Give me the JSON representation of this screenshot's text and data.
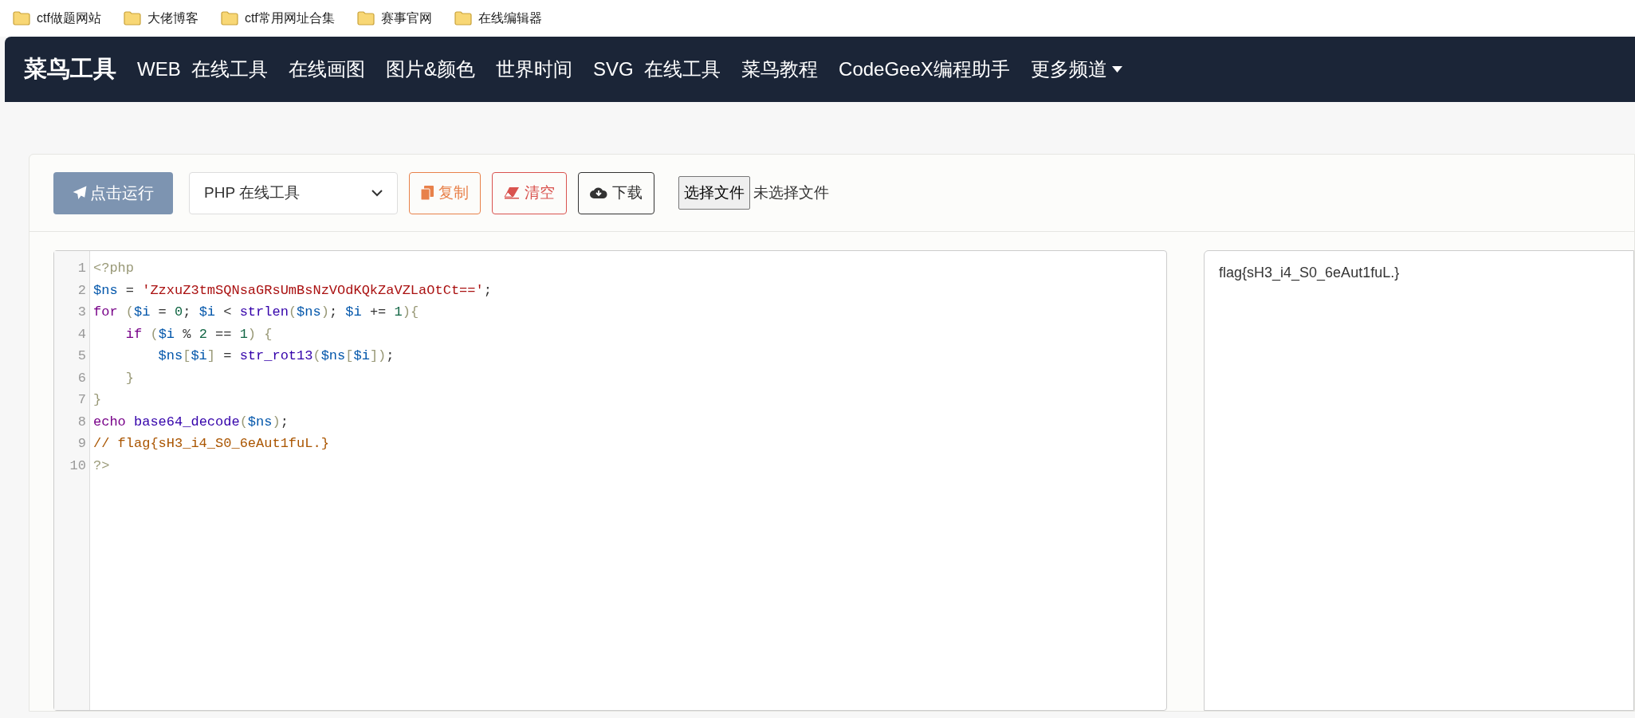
{
  "bookmarks": [
    "ctf做题网站",
    "大佬博客",
    "ctf常用网址合集",
    "赛事官网",
    "在线编辑器"
  ],
  "navbar": {
    "brand": "菜鸟工具",
    "links": [
      {
        "label": "WEB  在线工具",
        "dropdown": false
      },
      {
        "label": "在线画图",
        "dropdown": false
      },
      {
        "label": "图片&颜色",
        "dropdown": false
      },
      {
        "label": "世界时间",
        "dropdown": false
      },
      {
        "label": "SVG  在线工具",
        "dropdown": false
      },
      {
        "label": "菜鸟教程",
        "dropdown": false
      },
      {
        "label": "CodeGeeX编程助手",
        "dropdown": false
      },
      {
        "label": "更多频道",
        "dropdown": true
      }
    ]
  },
  "toolbar": {
    "run_button": "点击运行",
    "language_select": "PHP 在线工具",
    "buttons": [
      {
        "kind": "copy",
        "label": "复制"
      },
      {
        "kind": "clear",
        "label": "清空"
      },
      {
        "kind": "download",
        "label": "下载"
      }
    ],
    "file_button": "选择文件",
    "file_status": "未选择文件"
  },
  "editor": {
    "lines": [
      {
        "number": "1",
        "tokens": [
          {
            "kind": "bracket",
            "text": "<?php"
          }
        ]
      },
      {
        "number": "2",
        "tokens": [
          {
            "kind": "variable",
            "text": "$ns"
          },
          {
            "kind": "plain",
            "text": " = "
          },
          {
            "kind": "string",
            "text": "'ZzxuZ3tmSQNsaGRsUmBsNzVOdKQkZaVZLaOtCt=='"
          },
          {
            "kind": "plain",
            "text": ";"
          }
        ]
      },
      {
        "number": "3",
        "tokens": [
          {
            "kind": "keyword",
            "text": "for"
          },
          {
            "kind": "bracket",
            "text": " ("
          },
          {
            "kind": "variable",
            "text": "$i"
          },
          {
            "kind": "plain",
            "text": " = "
          },
          {
            "kind": "number",
            "text": "0"
          },
          {
            "kind": "plain",
            "text": "; "
          },
          {
            "kind": "variable",
            "text": "$i"
          },
          {
            "kind": "plain",
            "text": " < "
          },
          {
            "kind": "builtin",
            "text": "strlen"
          },
          {
            "kind": "bracket",
            "text": "("
          },
          {
            "kind": "variable",
            "text": "$ns"
          },
          {
            "kind": "bracket",
            "text": ")"
          },
          {
            "kind": "plain",
            "text": "; "
          },
          {
            "kind": "variable",
            "text": "$i"
          },
          {
            "kind": "plain",
            "text": " += "
          },
          {
            "kind": "number",
            "text": "1"
          },
          {
            "kind": "bracket",
            "text": "){"
          }
        ]
      },
      {
        "number": "4",
        "tokens": [
          {
            "kind": "keyword",
            "text": "    if"
          },
          {
            "kind": "bracket",
            "text": " ("
          },
          {
            "kind": "variable",
            "text": "$i"
          },
          {
            "kind": "plain",
            "text": " % "
          },
          {
            "kind": "number",
            "text": "2"
          },
          {
            "kind": "plain",
            "text": " == "
          },
          {
            "kind": "number",
            "text": "1"
          },
          {
            "kind": "bracket",
            "text": ") {"
          }
        ]
      },
      {
        "number": "5",
        "tokens": [
          {
            "kind": "variable",
            "text": "        $ns"
          },
          {
            "kind": "bracket",
            "text": "["
          },
          {
            "kind": "variable",
            "text": "$i"
          },
          {
            "kind": "bracket",
            "text": "]"
          },
          {
            "kind": "plain",
            "text": " = "
          },
          {
            "kind": "builtin",
            "text": "str_rot13"
          },
          {
            "kind": "bracket",
            "text": "("
          },
          {
            "kind": "variable",
            "text": "$ns"
          },
          {
            "kind": "bracket",
            "text": "["
          },
          {
            "kind": "variable",
            "text": "$i"
          },
          {
            "kind": "bracket",
            "text": "])"
          },
          {
            "kind": "plain",
            "text": ";"
          }
        ]
      },
      {
        "number": "6",
        "tokens": [
          {
            "kind": "bracket",
            "text": "    }"
          }
        ]
      },
      {
        "number": "7",
        "tokens": [
          {
            "kind": "bracket",
            "text": "}"
          }
        ]
      },
      {
        "number": "8",
        "tokens": [
          {
            "kind": "keyword",
            "text": "echo"
          },
          {
            "kind": "builtin",
            "text": " base64_decode"
          },
          {
            "kind": "bracket",
            "text": "("
          },
          {
            "kind": "variable",
            "text": "$ns"
          },
          {
            "kind": "bracket",
            "text": ")"
          },
          {
            "kind": "plain",
            "text": ";"
          }
        ]
      },
      {
        "number": "9",
        "tokens": [
          {
            "kind": "comment",
            "text": "// flag{sH3_i4_S0_6eAut1fuL.}"
          }
        ]
      },
      {
        "number": "10",
        "tokens": [
          {
            "kind": "bracket",
            "text": "?>"
          }
        ]
      }
    ]
  },
  "output": "flag{sH3_i4_S0_6eAut1fuL.}"
}
